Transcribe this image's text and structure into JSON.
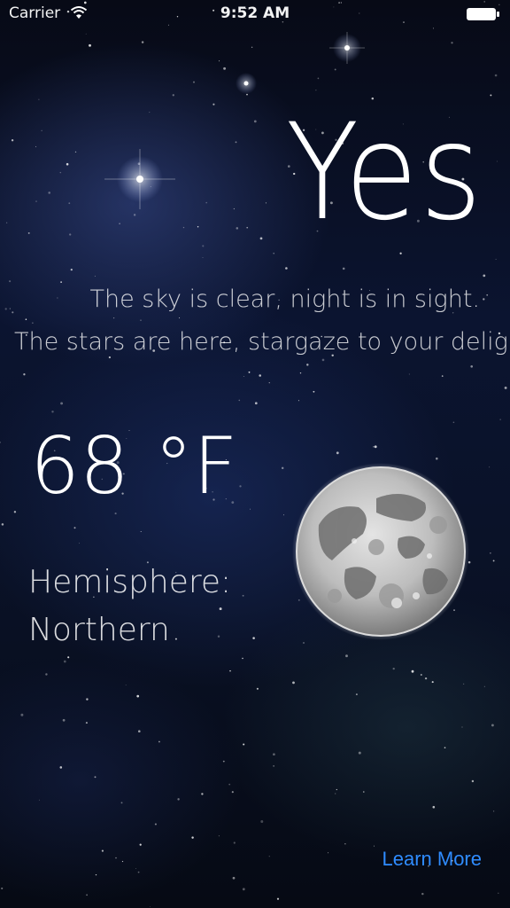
{
  "status_bar": {
    "carrier": "Carrier",
    "time": "9:52 AM",
    "wifi_icon": "wifi-icon",
    "battery_icon": "battery-icon"
  },
  "main": {
    "answer": "Yes",
    "message_line1": "The sky is clear, night is in sight.",
    "message_line2": "The stars are here, stargaze to your delight",
    "temperature": "68 °F",
    "hemisphere_label": "Hemisphere:",
    "hemisphere_value": "Northern",
    "moon_icon": "full-moon-image"
  },
  "footer": {
    "learn_more_label": "Learn More"
  },
  "colors": {
    "link": "#2f8cff",
    "background": "#0b1430",
    "text": "#ffffff"
  }
}
